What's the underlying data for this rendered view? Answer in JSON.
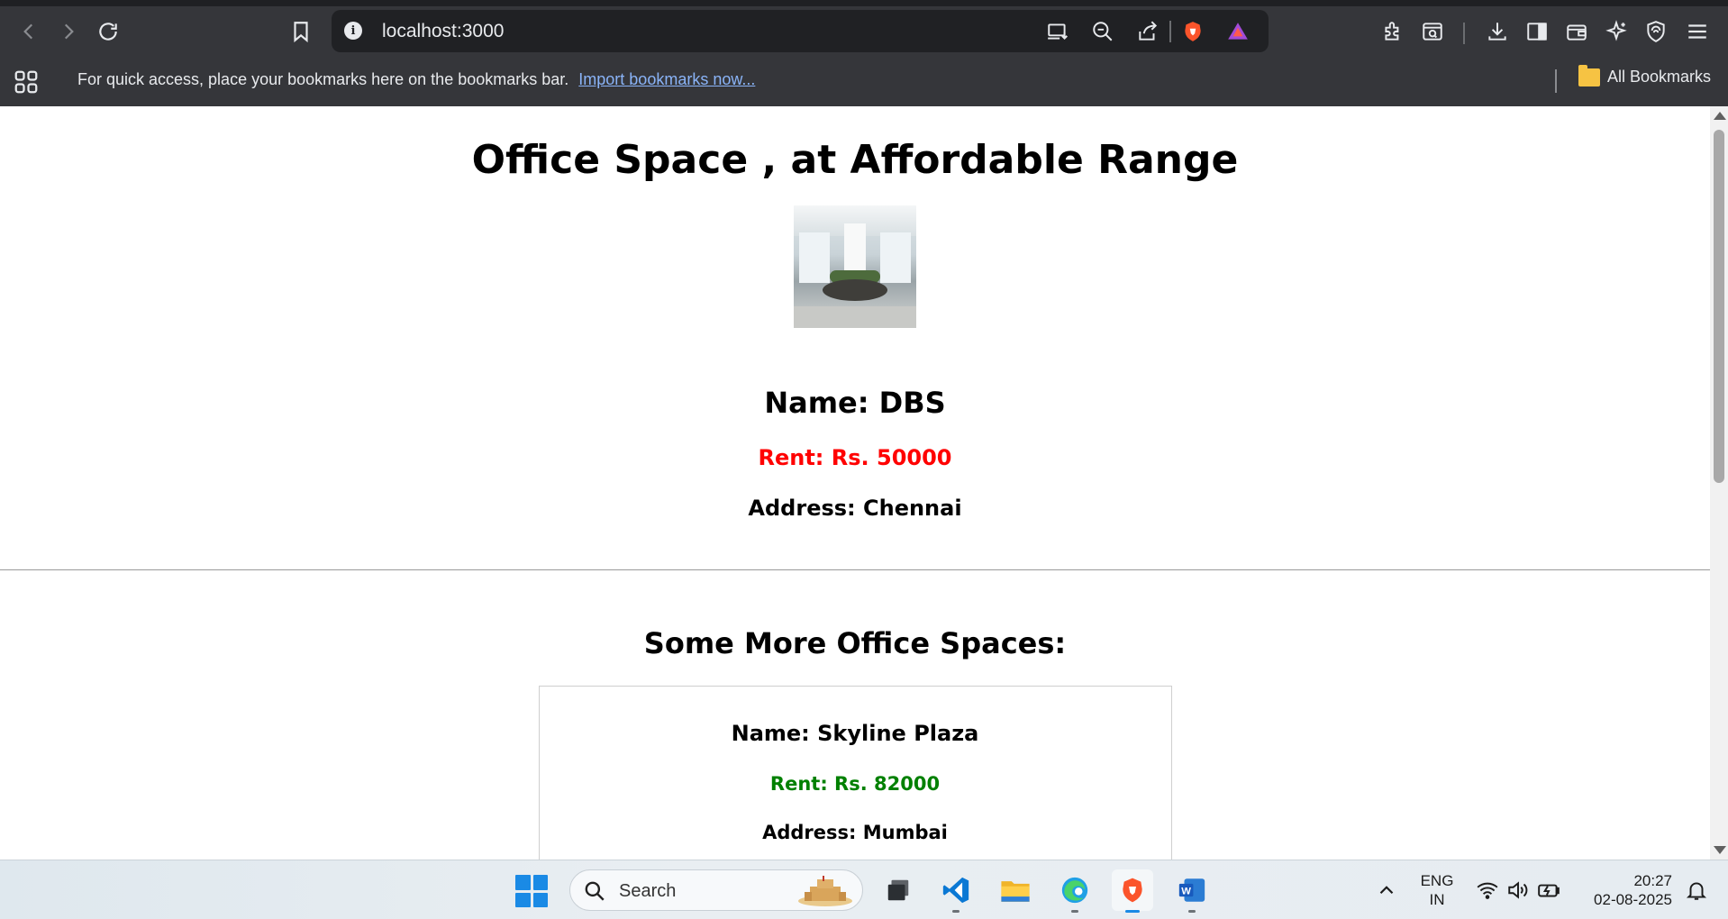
{
  "browser": {
    "url": "localhost:3000",
    "bookmarks_bar": {
      "message": "For quick access, place your bookmarks here on the bookmarks bar.",
      "import_link": "Import bookmarks now...",
      "all_bookmarks": "All Bookmarks"
    }
  },
  "page": {
    "title": "Office Space , at Affordable Range",
    "featured": {
      "name": "Name: DBS",
      "rent": "Rent: Rs. 50000",
      "rent_color": "#ff0000",
      "address": "Address: Chennai"
    },
    "more_heading": "Some More Office Spaces:",
    "listings": [
      {
        "name": "Name: Skyline Plaza",
        "rent": "Rent: Rs. 82000",
        "rent_color": "#008000",
        "address": "Address: Mumbai"
      }
    ]
  },
  "taskbar": {
    "search_placeholder": "Search",
    "language_line1": "ENG",
    "language_line2": "IN",
    "time": "20:27",
    "date": "02-08-2025"
  },
  "colors": {
    "chrome_bg": "#35363a",
    "omnibox_bg": "#202124",
    "link": "#8ab4f8",
    "accent": "#1a8ae5"
  }
}
